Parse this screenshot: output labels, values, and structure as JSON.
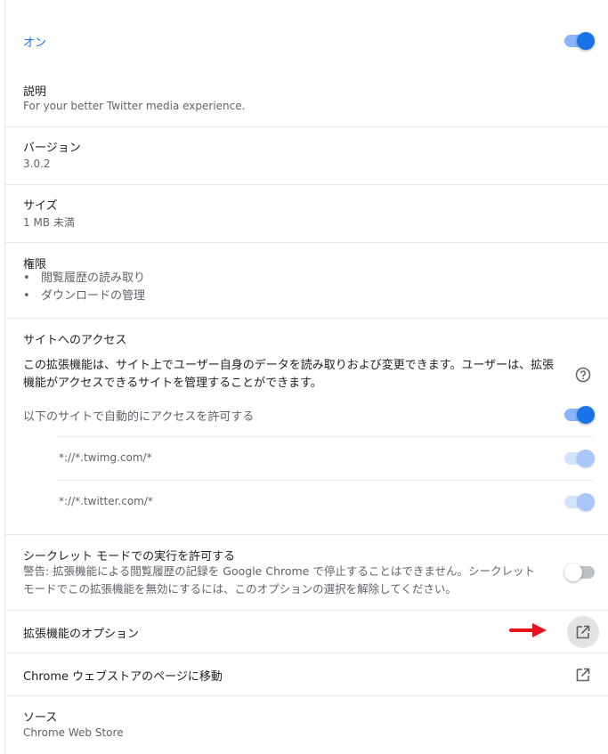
{
  "enabled": {
    "label": "オン"
  },
  "description": {
    "title": "説明",
    "value": "For your better Twitter media experience."
  },
  "version": {
    "title": "バージョン",
    "value": "3.0.2"
  },
  "size": {
    "title": "サイズ",
    "value": "1 MB 未満"
  },
  "permissions": {
    "title": "権限",
    "items": [
      "閲覧履歴の読み取り",
      "ダウンロードの管理"
    ]
  },
  "site_access": {
    "title": "サイトへのアクセス",
    "description": "この拡張機能は、サイト上でユーザー自身のデータを読み取りおよび変更できます。ユーザーは、拡張機能がアクセスできるサイトを管理することができます。",
    "auto_allow_label": "以下のサイトで自動的にアクセスを許可する",
    "sites": [
      "*://*.twimg.com/*",
      "*://*.twitter.com/*"
    ]
  },
  "incognito": {
    "title": "シークレット モードでの実行を許可する",
    "warning": "警告: 拡張機能による閲覧履歴の記録を Google Chrome で停止することはできません。シークレット モードでこの拡張機能を無効にするには、このオプションの選択を解除してください。"
  },
  "options": {
    "label": "拡張機能のオプション"
  },
  "web_store": {
    "label": "Chrome ウェブストアのページに移動"
  },
  "source": {
    "title": "ソース",
    "value": "Chrome Web Store"
  },
  "colors": {
    "accent": "#1a73e8",
    "annotation_arrow": "#e8141c"
  },
  "icons": {
    "help": "help-circle-icon",
    "external": "open-in-new-icon"
  }
}
